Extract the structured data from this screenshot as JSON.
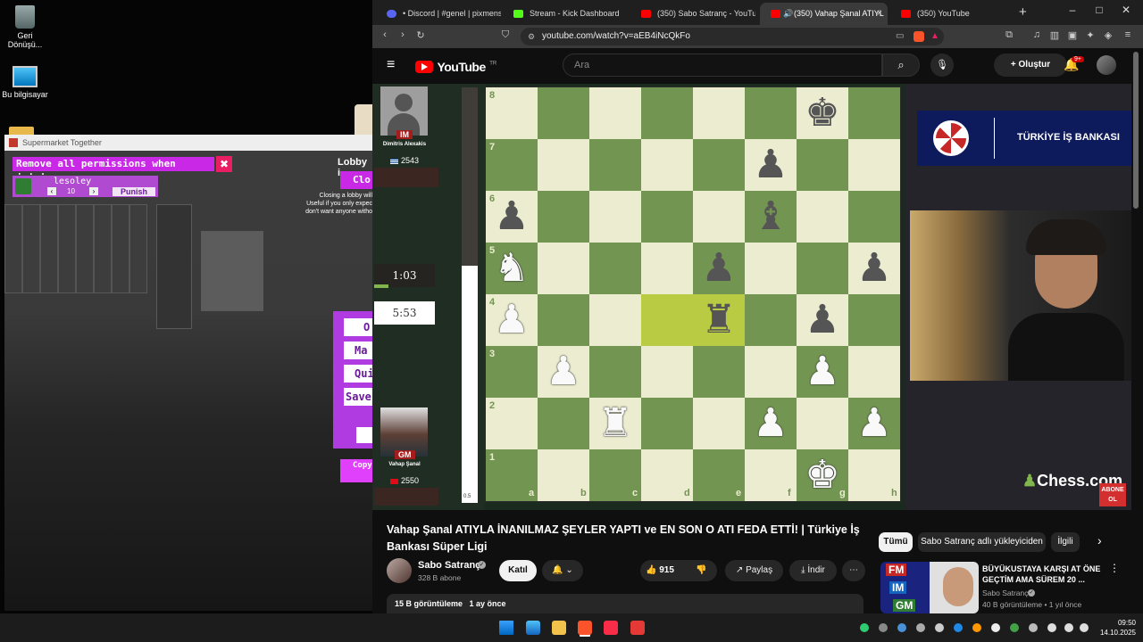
{
  "desktop": {
    "icons": [
      {
        "label": "Geri Dönüşü...",
        "icon": "recycle-bin-icon"
      },
      {
        "label": "Bu bilgisayar",
        "icon": "computer-icon"
      }
    ]
  },
  "game_window": {
    "title": "Supermarket Together",
    "remove_permissions": "Remove all permissions when joining",
    "close_x": "✖",
    "player_name": "lesoley",
    "player_value": "10",
    "punish": "Punish",
    "lobby_heading": "Lobby i",
    "close_btn": "Clo",
    "lobby_note_line1": "Closing a lobby will",
    "lobby_note_line2": "Useful if you only expec",
    "lobby_note_line3": "don't want anyone witho",
    "menu": [
      "O",
      "Ma",
      "Qui",
      "Save"
    ],
    "copy_btn": "Copy"
  },
  "browser": {
    "tabs": [
      {
        "label": "• Discord | #genel | pixmens",
        "color": "#5865f2"
      },
      {
        "label": "Stream - Kick Dashboard",
        "color": "#53fc18"
      },
      {
        "label": "(350) Sabo Satranç - YouTube",
        "color": "#ff0000"
      },
      {
        "label": "(350) Vahap Şanal ATIYL",
        "color": "#ff0000",
        "active": true
      },
      {
        "label": "(350) YouTube",
        "color": "#ff0000"
      }
    ],
    "new_tab": "+",
    "url": "youtube.com/watch?v=aEB4iNcQkFo"
  },
  "youtube": {
    "logo_text": "YouTube",
    "logo_sup": "TR",
    "search_placeholder": "Ara",
    "create_label": "Oluştur",
    "notif_badge": "9+",
    "video_title_line1": "Vahap Şanal ATIYLA İNANILMAZ ŞEYLER YAPTI ve EN SON O ATI FEDA ETTİ! | Türkiye İş",
    "video_title_line2": "Bankası Süper Ligi",
    "channel_name": "Sabo Satranç",
    "subscribers": "328 B abone",
    "join_label": "Katıl",
    "likes": "915",
    "share_label": "Paylaş",
    "download_label": "İndir",
    "views_line": "15 B görüntüleme   1 ay önce",
    "chips": [
      "Tümü",
      "Sabo Satranç adlı yükleyiciden",
      "İlgili"
    ],
    "suggested": {
      "title_line1": "BÜYÜKUSTAYA KARŞI AT ÖNE",
      "title_line2": "GEÇTİM AMA SÜREM 20 ...",
      "channel": "Sabo Satranç",
      "meta": "40 B görüntüleme • 1 yıl önce",
      "thumb_badges": [
        "FM",
        "IM",
        "GM"
      ]
    }
  },
  "chess": {
    "top_player": {
      "title": "IM",
      "name": "Dimitris Alexakis",
      "rating": "2543",
      "clock": "1:03"
    },
    "bottom_player": {
      "title": "GM",
      "name": "Vahap Şanal",
      "rating": "2550",
      "clock": "5:53"
    },
    "eval_label": "0.5",
    "eval_white_fraction": 0.57,
    "files": [
      "a",
      "b",
      "c",
      "d",
      "e",
      "f",
      "g",
      "h"
    ],
    "ranks": [
      "8",
      "7",
      "6",
      "5",
      "4",
      "3",
      "2",
      "1"
    ],
    "pieces": [
      {
        "sq": "g8",
        "p": "♚",
        "c": "b"
      },
      {
        "sq": "f7",
        "p": "♟",
        "c": "b"
      },
      {
        "sq": "a6",
        "p": "♟",
        "c": "b"
      },
      {
        "sq": "f6",
        "p": "♝",
        "c": "b"
      },
      {
        "sq": "a5",
        "p": "♞",
        "c": "w"
      },
      {
        "sq": "e5",
        "p": "♟",
        "c": "b"
      },
      {
        "sq": "h5",
        "p": "♟",
        "c": "b"
      },
      {
        "sq": "a4",
        "p": "♟",
        "c": "w"
      },
      {
        "sq": "e4",
        "p": "♜",
        "c": "b"
      },
      {
        "sq": "g4",
        "p": "♟",
        "c": "b"
      },
      {
        "sq": "b3",
        "p": "♟",
        "c": "w"
      },
      {
        "sq": "g3",
        "p": "♟",
        "c": "w"
      },
      {
        "sq": "c2",
        "p": "♜",
        "c": "w"
      },
      {
        "sq": "f2",
        "p": "♟",
        "c": "w"
      },
      {
        "sq": "h2",
        "p": "♟",
        "c": "w"
      },
      {
        "sq": "g1",
        "p": "♚",
        "c": "w"
      }
    ],
    "highlight": [
      "d4",
      "e4"
    ],
    "sponsor": "TÜRKİYE İŞ BANKASI",
    "brand": "Chess.com",
    "abone": "ABONE OL"
  },
  "taskbar": {
    "time": "09:50",
    "date": "14.10.2025"
  }
}
